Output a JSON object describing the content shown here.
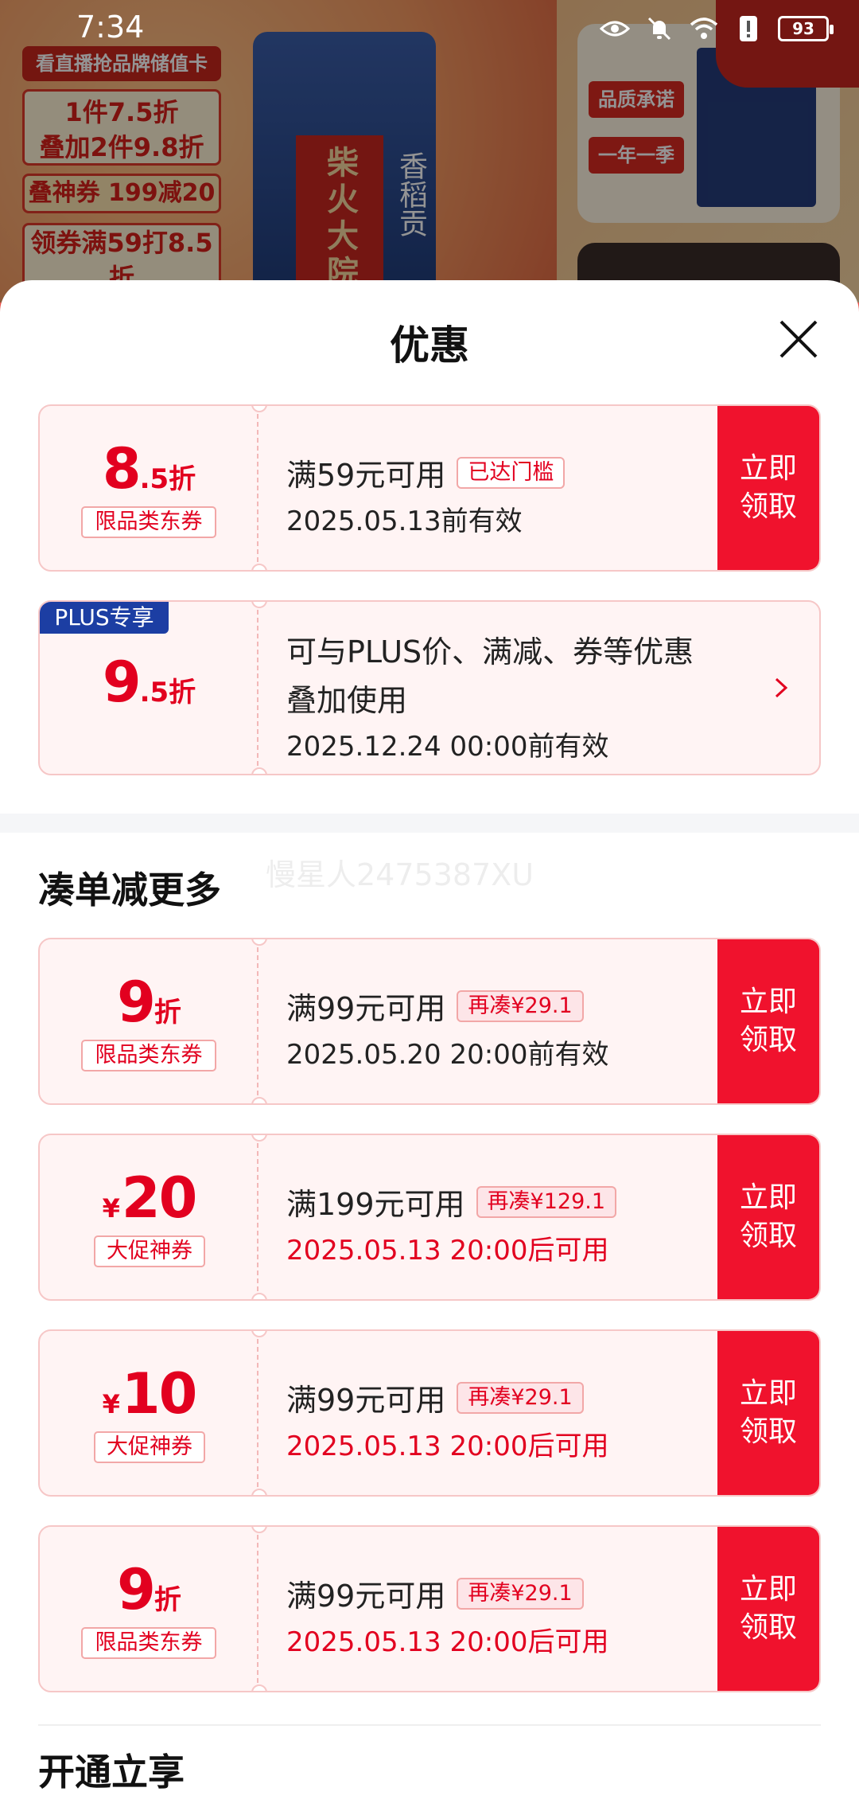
{
  "status_bar": {
    "time": "7:34",
    "battery": "93"
  },
  "background": {
    "banner": "看直播抢品牌储值卡",
    "deal1_line1": "1件7.5折",
    "deal1_line2": "叠加2件9.8折",
    "deal2": "叠神券 199减20",
    "deal3": "领券满59打8.5折",
    "bag_label": "柴火大院",
    "bag_side": "香稻贡",
    "right_tag1": "品质承诺",
    "right_tag2": "一年一季"
  },
  "sheet": {
    "title": "优惠",
    "watermark": "慢星人2475387XU",
    "coupons_top": [
      {
        "value_big": "8",
        "value_small": ".5折",
        "tag": "限品类东券",
        "condition": "满59元可用",
        "badge": "已达门槛",
        "date": "2025.05.13前有效",
        "button": "立即\n领取"
      },
      {
        "plus_badge": "PLUS专享",
        "value_big": "9",
        "value_small": ".5折",
        "desc_line1": "可与PLUS价、满减、券等优惠",
        "desc_line2": "叠加使用",
        "date": "2025.12.24 00:00前有效"
      }
    ],
    "section_more": "凑单减更多",
    "coupons_more": [
      {
        "value_big": "9",
        "value_small": "折",
        "tag": "限品类东券",
        "condition": "满99元可用",
        "badge": "再凑¥29.1",
        "date": "2025.05.20 20:00前有效",
        "date_red": false,
        "button": "立即\n领取"
      },
      {
        "yen": "¥",
        "value_big": "20",
        "tag": "大促神券",
        "condition": "满199元可用",
        "badge": "再凑¥129.1",
        "date": "2025.05.13 20:00后可用",
        "date_red": true,
        "button": "立即\n领取"
      },
      {
        "yen": "¥",
        "value_big": "10",
        "tag": "大促神券",
        "condition": "满99元可用",
        "badge": "再凑¥29.1",
        "date": "2025.05.13 20:00后可用",
        "date_red": true,
        "button": "立即\n领取"
      },
      {
        "value_big": "9",
        "value_small": "折",
        "tag": "限品类东券",
        "condition": "满99元可用",
        "badge": "再凑¥29.1",
        "date": "2025.05.13 20:00后可用",
        "date_red": true,
        "button": "立即\n领取"
      }
    ],
    "section_open": "开通立享"
  },
  "colors": {
    "accent": "#f0122d",
    "plus": "#1c3ea3",
    "coupon_bg": "#fff4f4"
  }
}
